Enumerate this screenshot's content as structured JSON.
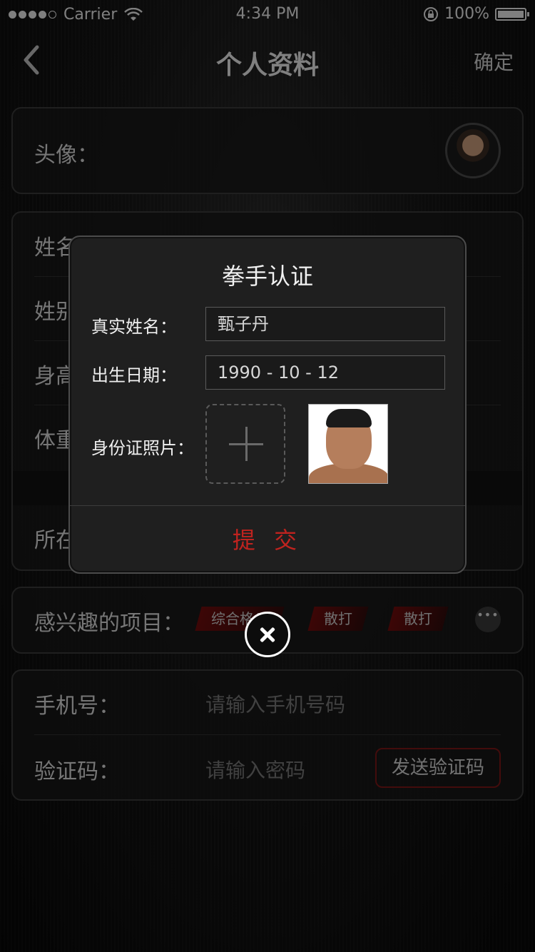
{
  "status_bar": {
    "carrier": "Carrier",
    "time": "4:34 PM",
    "battery": "100%"
  },
  "nav": {
    "title": "个人资料",
    "confirm": "确定"
  },
  "profile": {
    "avatar_label": "头像：",
    "basic_rows": [
      "姓名",
      "姓别",
      "身高",
      "体重"
    ],
    "location_label": "所在",
    "interests_label": "感兴趣的项目：",
    "interest_tags": [
      "综合格斗",
      "散打",
      "散打"
    ],
    "phone_label": "手机号：",
    "phone_placeholder": "请输入手机号码",
    "code_label": "验证码：",
    "code_placeholder": "请输入密码",
    "send_code": "发送验证码"
  },
  "modal": {
    "title": "拳手认证",
    "real_name_label": "真实姓名：",
    "real_name_value": "甄子丹",
    "birth_label": "出生日期：",
    "birth_value": "1990 - 10 - 12",
    "id_photo_label": "身份证照片：",
    "submit": "提 交"
  },
  "colors": {
    "accent_red": "#c0231f",
    "background": "#0b0b0b",
    "modal_bg": "#1f1f1f"
  }
}
